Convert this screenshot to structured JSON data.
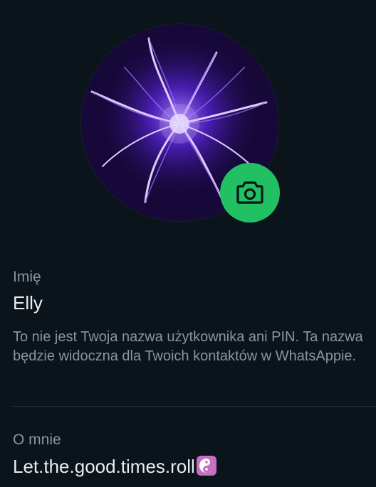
{
  "profile": {
    "avatar_icon": "purple-flame-flower-photo",
    "camera_icon": "camera-icon",
    "accent_color": "#21c063"
  },
  "name": {
    "label": "Imię",
    "value": "Elly",
    "hint": "To nie jest Twoja nazwa użytkownika ani PIN. Ta nazwa będzie widoczna dla Twoich kontaktów w WhatsAppie."
  },
  "about": {
    "label": "O mnie",
    "value": "Let.the.good.times.roll",
    "emoji_icon": "yin-yang-icon"
  }
}
